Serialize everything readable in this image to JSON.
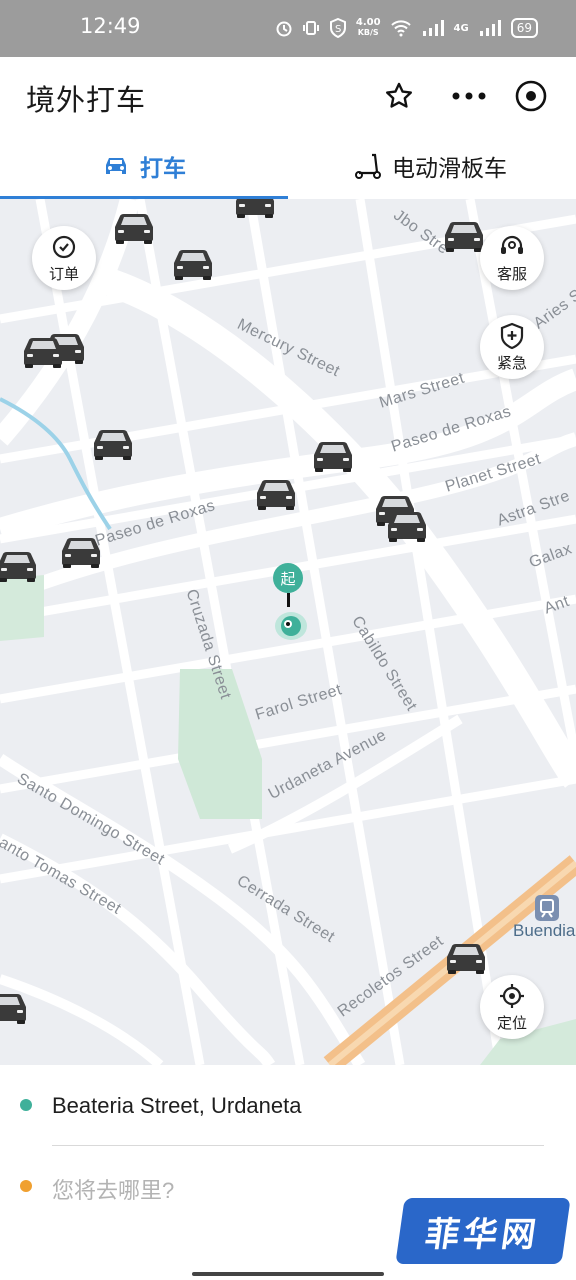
{
  "status_bar": {
    "time": "12:49",
    "net_speed_value": "4.00",
    "net_speed_unit": "KB/S",
    "network_type": "4G",
    "battery": "69"
  },
  "header": {
    "title": "境外打车"
  },
  "tabs": [
    {
      "label": "打车",
      "icon": "car-icon",
      "active": true
    },
    {
      "label": "电动滑板车",
      "icon": "scooter-icon",
      "active": false
    }
  ],
  "map": {
    "buttons": {
      "orders": "订单",
      "customer_service": "客服",
      "emergency": "紧急",
      "locate": "定位"
    },
    "start_marker": "起",
    "station": "Buendia",
    "streets": [
      "Mercury Street",
      "Mars Street",
      "Paseo de Roxas",
      "Planet Street",
      "Astra Stre",
      "Galax",
      "Ant",
      "Paseo de Roxas",
      "Cruzada Street",
      "Cabildo Street",
      "Farol Street",
      "Urdaneta Avenue",
      "Santo Domingo Street",
      "anto Tomas Street",
      "Cerrada Street",
      "Recoletos Street",
      "Aries S",
      "Jbo Stre"
    ]
  },
  "trip": {
    "pickup": "Beateria Street, Urdaneta",
    "destination_placeholder": "您将去哪里?"
  },
  "watermark": "菲华网",
  "colors": {
    "accent": "#2f7fd6",
    "pickup_dot": "#3fb09a",
    "destination_dot": "#f0a030",
    "rail_line": "#f3c08a"
  }
}
